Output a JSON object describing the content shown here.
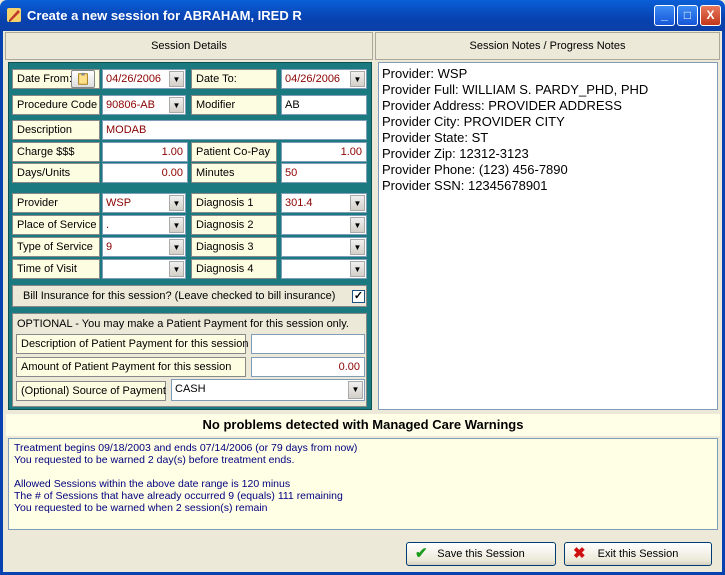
{
  "window": {
    "title": "Create a new session for ABRAHAM, IRED R",
    "minimize": "_",
    "maximize": "□",
    "close": "X"
  },
  "headers": {
    "session_details": "Session Details",
    "session_notes": "Session Notes / Progress Notes"
  },
  "form": {
    "date_from_label": "Date From:",
    "date_from": "04/26/2006",
    "date_to_label": "Date To:",
    "date_to": "04/26/2006",
    "procedure_code_label": "Procedure Code",
    "procedure_code": "90806-AB",
    "modifier_label": "Modifier",
    "modifier": "AB",
    "description_label": "Description",
    "description": "MODAB",
    "charge_label": "Charge  $$$",
    "charge": "1.00",
    "copay_label": "Patient Co-Pay",
    "copay": "1.00",
    "days_units_label": "Days/Units",
    "days_units": "0.00",
    "minutes_label": "Minutes",
    "minutes": "50",
    "provider_label": "Provider",
    "provider": "WSP",
    "diagnosis1_label": "Diagnosis 1",
    "diagnosis1": "301.4",
    "place_of_service_label": "Place of Service",
    "place_of_service": ".",
    "diagnosis2_label": "Diagnosis 2",
    "diagnosis2": "",
    "type_of_service_label": "Type of Service",
    "type_of_service": "9",
    "diagnosis3_label": "Diagnosis 3",
    "diagnosis3": "",
    "time_of_visit_label": "Time of Visit",
    "time_of_visit": "",
    "diagnosis4_label": "Diagnosis 4",
    "diagnosis4": "",
    "bill_insurance_label": "Bill Insurance for this session?  (Leave checked to bill insurance)",
    "bill_insurance_checked": true
  },
  "optional": {
    "heading": "OPTIONAL - You may make a Patient Payment for this session only.",
    "payment_desc_label": "Description of Patient Payment for this session",
    "payment_desc": "",
    "payment_amount_label": "Amount of Patient Payment for this session",
    "payment_amount": "0.00",
    "source_label": "(Optional) Source of Payment",
    "source": "CASH"
  },
  "notes": [
    "Provider: WSP",
    "Provider Full: WILLIAM S. PARDY_PHD, PHD",
    "Provider Address: PROVIDER ADDRESS",
    "Provider City: PROVIDER CITY",
    "Provider State: ST",
    "Provider Zip: 12312-3123",
    "Provider Phone: (123) 456-7890",
    "Provider SSN: 12345678901"
  ],
  "warnings": {
    "heading": "No problems detected with Managed Care Warnings",
    "lines": [
      "Treatment begins 09/18/2003 and ends 07/14/2006 (or 79 days from now)",
      "You requested to be warned 2 day(s) before treatment ends.",
      "",
      "Allowed Sessions within the above date range is 120 minus",
      "The # of Sessions that have already occurred 9 (equals) 111 remaining",
      "You requested to be warned when 2 session(s) remain"
    ]
  },
  "buttons": {
    "save": "Save this Session",
    "exit": "Exit this Session"
  },
  "colors": {
    "panel": "#1a7a80",
    "field_text": "#8b0000",
    "warning_text": "#00007f"
  }
}
